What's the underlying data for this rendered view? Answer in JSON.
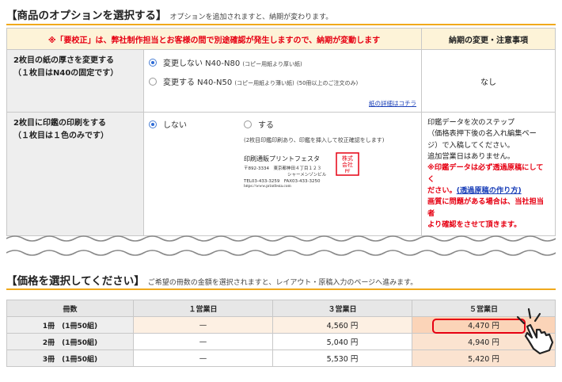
{
  "options_section": {
    "title": "【商品のオプションを選択する】",
    "desc": "オプションを追加されますと、納期が変わります。"
  },
  "options_table": {
    "header_warning": "※「要校正」は、弊社制作担当とお客様の間で別途確認が発生しますので、納期が変動します",
    "header_notes": "納期の変更・注意事項",
    "paper_row": {
      "label_1": "2枚目の紙の厚さを変更する",
      "label_2": "（１枚目はN40の固定です）",
      "option_1": "変更しない N40-N80",
      "option_1_note": "(コピー用紙より厚い紙)",
      "option_2": "変更する N40-N50",
      "option_2_note": "(コピー用紙より薄い紙)",
      "option_2_note2": "(50冊以上のご注文のみ)",
      "detail_link": "紙の詳細はコチラ",
      "notes": "なし"
    },
    "stamp_row": {
      "label_1": "2枚目に印鑑の印刷をする",
      "label_2": "（１枚目は１色のみです）",
      "option_1": "しない",
      "option_2": "する",
      "option_2_note": "(2枚目印鑑印刷あり、印鑑を挿入して校正確認をします)",
      "sample": {
        "company": "印刷通販プリントフェスタ",
        "address_1": "〒892-3334　東京都神田４丁目１２３",
        "address_2": "シャーメンゾンビル",
        "tel": "TEL03-433-3259　FAX03-433-3250",
        "url": "https://www.printfesta.com",
        "seal_text": "株式会社プリントフェスタ"
      },
      "notes": {
        "line_1": "印鑑データを次のステップ",
        "line_2": "（価格表押下後の名入れ編集ペー",
        "line_3": "ジ）で入稿してください。",
        "line_4": "追加営業日はありません。",
        "red_1": "※印鑑データは必ず透過原稿にしてく",
        "red_2": "ださい。",
        "blue_link": "(透過原稿の作り方)",
        "red_3": "画質に問題がある場合は、当社担当者",
        "red_4": "より確認をさせて頂きます。"
      }
    }
  },
  "price_section": {
    "title": "【価格を選択してください】",
    "desc": "ご希望の冊数の金額を選択されますと、レイアウト・原稿入力のページへ進みます。"
  },
  "price_table": {
    "headers": [
      "冊数",
      "１営業日",
      "３営業日",
      "５営業日"
    ],
    "rows": [
      {
        "qty": "1冊　(1冊50組)",
        "d1": "—",
        "d3": "4,560 円",
        "d5": "4,470 円"
      },
      {
        "qty": "2冊　(1冊50組)",
        "d1": "—",
        "d3": "5,040 円",
        "d5": "4,940 円"
      },
      {
        "qty": "3冊　(1冊50組)",
        "d1": "—",
        "d3": "5,530 円",
        "d5": "5,420 円"
      }
    ]
  },
  "colors": {
    "accent_orange": "#f0a91c",
    "warning_red": "#e60012",
    "link_blue": "#1a3fb8"
  }
}
